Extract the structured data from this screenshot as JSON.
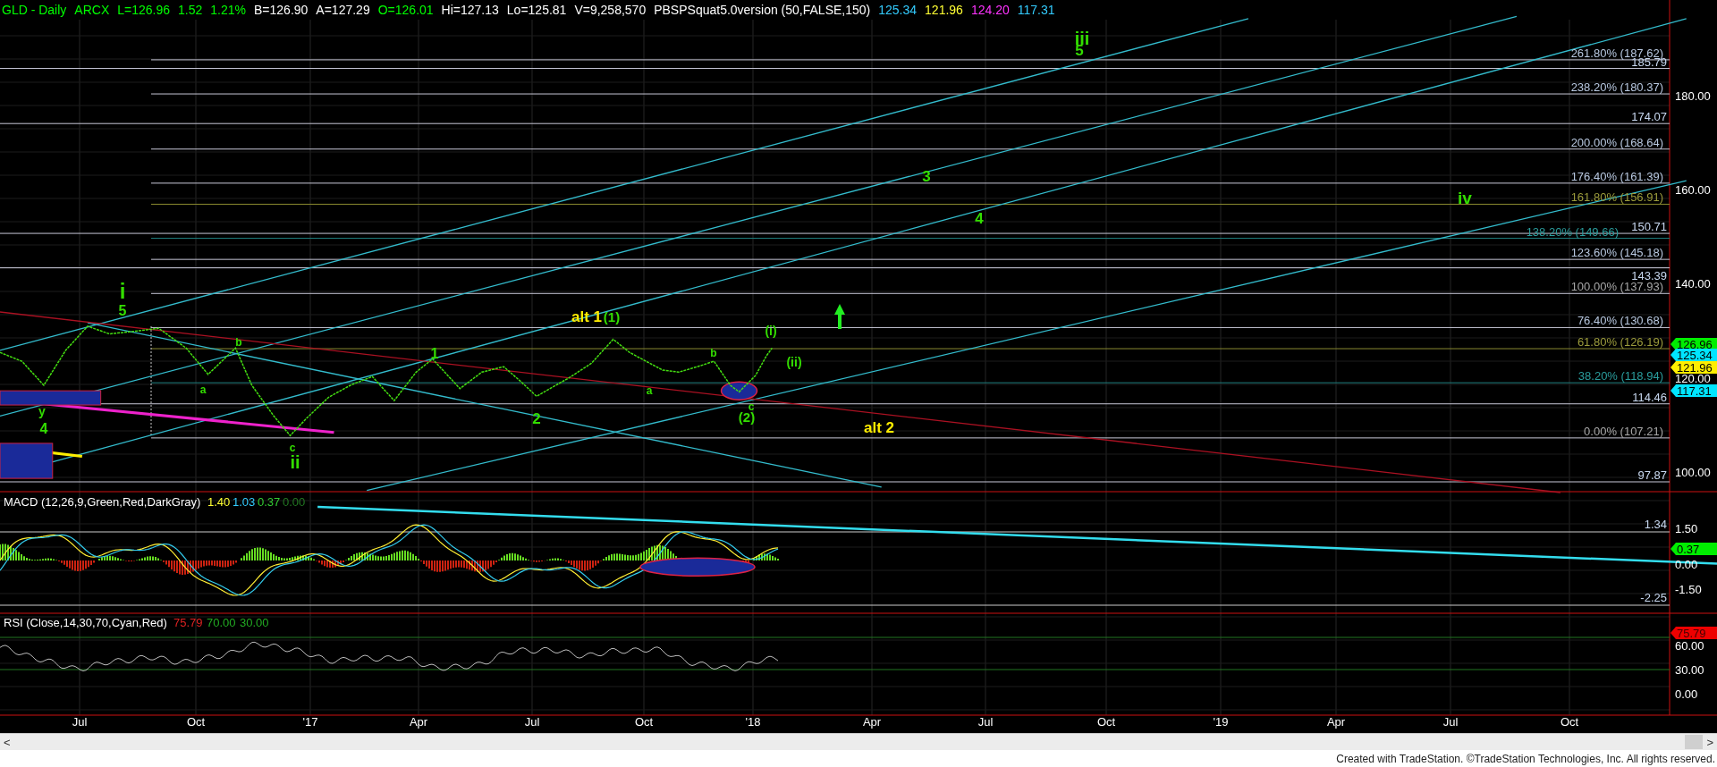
{
  "header": [
    {
      "text": "GLD - Daily",
      "color": "#00ff00"
    },
    {
      "text": "ARCX",
      "color": "#00ff00"
    },
    {
      "text": "L=126.96",
      "color": "#00ff00"
    },
    {
      "text": "1.52",
      "color": "#00ff00"
    },
    {
      "text": "1.21%",
      "color": "#00ff00"
    },
    {
      "text": "B=126.90",
      "color": "#ffffff"
    },
    {
      "text": "A=127.29",
      "color": "#ffffff"
    },
    {
      "text": "O=126.01",
      "color": "#00ff00"
    },
    {
      "text": "Hi=127.13",
      "color": "#ffffff"
    },
    {
      "text": "Lo=125.81",
      "color": "#ffffff"
    },
    {
      "text": "V=9,258,570",
      "color": "#ffffff"
    },
    {
      "text": "PBSPSquat5.0version (50,FALSE,150)",
      "color": "#ffffff"
    },
    {
      "text": "125.34",
      "color": "#33ccff"
    },
    {
      "text": "121.96",
      "color": "#ffff33"
    },
    {
      "text": "124.20",
      "color": "#ff33ff"
    },
    {
      "text": "117.31",
      "color": "#33ccff"
    }
  ],
  "price_axis": [
    "180.00",
    "160.00",
    "140.00",
    "120.00",
    "100.00"
  ],
  "fib_levels": [
    {
      "text": "261.80% (187.62)",
      "color": "#b8c8e0"
    },
    {
      "text": "238.20% (180.37)",
      "color": "#b8c8e0"
    },
    {
      "text": "200.00% (168.64)",
      "color": "#b8c8e0"
    },
    {
      "text": "176.40% (161.39)",
      "color": "#b8c8e0"
    },
    {
      "text": "161.80% (156.91)",
      "color": "#9c9c3c"
    },
    {
      "text": "138.20% (149.66)",
      "color": "#2a9d9d"
    },
    {
      "text": "123.60% (145.18)",
      "color": "#b8c8e0"
    },
    {
      "text": "100.00% (137.93)",
      "color": "#a8a8a8"
    },
    {
      "text": "76.40% (130.68)",
      "color": "#b8c8e0"
    },
    {
      "text": "61.80% (126.19)",
      "color": "#9c9c3c"
    },
    {
      "text": "38.20% (118.94)",
      "color": "#2a9d9d"
    },
    {
      "text": "0.00% (107.21)",
      "color": "#a8a8a8"
    }
  ],
  "line_labels": [
    "185.79",
    "174.07",
    "150.71",
    "143.39",
    "114.46",
    "97.87"
  ],
  "price_markers": [
    {
      "text": "126.96",
      "color": "#00ee00"
    },
    {
      "text": "125.34",
      "color": "#00e5ff"
    },
    {
      "text": "121.96",
      "color": "#ffee00"
    },
    {
      "text": "117.31",
      "color": "#00e5ff"
    }
  ],
  "wave_labels": [
    {
      "text": "iii",
      "color": "#33dd00"
    },
    {
      "text": "5",
      "color": "#33dd00"
    },
    {
      "text": "3",
      "color": "#33dd00"
    },
    {
      "text": "4",
      "color": "#33dd00"
    },
    {
      "text": "iv",
      "color": "#33dd00"
    },
    {
      "text": "i",
      "color": "#33dd00"
    },
    {
      "text": "5",
      "color": "#33dd00"
    },
    {
      "text": "alt 1",
      "color": "#ffee00"
    },
    {
      "text": "(1)",
      "color": "#33dd00"
    },
    {
      "text": "1",
      "color": "#33dd00"
    },
    {
      "text": "b",
      "color": "#33dd00"
    },
    {
      "text": "a",
      "color": "#33dd00"
    },
    {
      "text": "2",
      "color": "#33dd00"
    },
    {
      "text": "b",
      "color": "#33dd00"
    },
    {
      "text": "a",
      "color": "#33dd00"
    },
    {
      "text": "c",
      "color": "#33dd00"
    },
    {
      "text": "(2)",
      "color": "#33dd00"
    },
    {
      "text": "(i)",
      "color": "#33dd00"
    },
    {
      "text": "(ii)",
      "color": "#33dd00"
    },
    {
      "text": "alt 2",
      "color": "#ffee00"
    },
    {
      "text": "y",
      "color": "#33dd00"
    },
    {
      "text": "4",
      "color": "#33dd00"
    },
    {
      "text": "c",
      "color": "#33dd00"
    },
    {
      "text": "ii",
      "color": "#33dd00"
    }
  ],
  "macd": {
    "title": "MACD (12,26,9,Green,Red,DarkGray)",
    "values": [
      {
        "text": "1.40",
        "color": "#ffff33"
      },
      {
        "text": "1.03",
        "color": "#33ccff"
      },
      {
        "text": "0.37",
        "color": "#33cc33"
      },
      {
        "text": "0.00",
        "color": "#227722"
      }
    ],
    "levels": [
      "1.34",
      "-2.25"
    ],
    "axis": [
      "1.50",
      "0.00",
      "-1.50"
    ],
    "marker": {
      "text": "0.37",
      "color": "#00ee00"
    }
  },
  "rsi": {
    "title": "RSI (Close,14,30,70,Cyan,Red)",
    "values": [
      {
        "text": "75.79",
        "color": "#dd2222"
      },
      {
        "text": "70.00",
        "color": "#22aa22"
      },
      {
        "text": "30.00",
        "color": "#22aa22"
      }
    ],
    "axis": [
      "60.00",
      "30.00",
      "0.00"
    ],
    "marker": {
      "text": "75.79",
      "color": "#ee0000"
    }
  },
  "date_axis": [
    "Jul",
    "Oct",
    "'17",
    "Apr",
    "Jul",
    "Oct",
    "'18",
    "Apr",
    "Jul",
    "Oct",
    "'19",
    "Apr",
    "Jul",
    "Oct"
  ],
  "scrollbar": {
    "left": "<",
    "right": ">"
  },
  "footer": "Created with TradeStation. ©TradeStation Technologies, Inc. All rights reserved."
}
